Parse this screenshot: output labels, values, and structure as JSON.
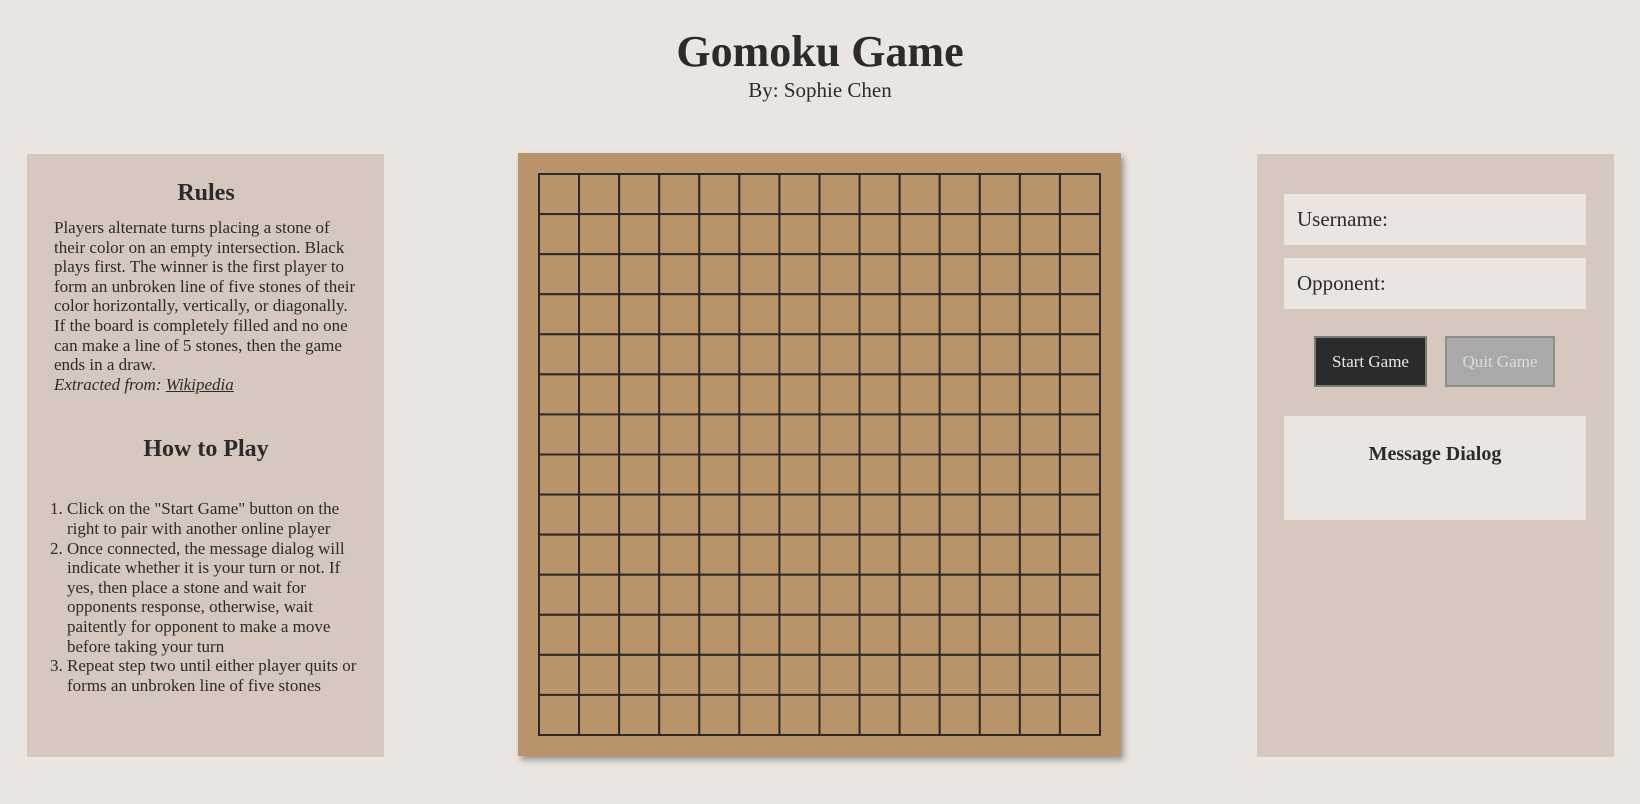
{
  "header": {
    "title": "Gomoku Game",
    "subtitle": "By: Sophie Chen"
  },
  "rules": {
    "heading": "Rules",
    "text": "Players alternate turns placing a stone of their color on an empty intersection. Black plays first. The winner is the first player to form an unbroken line of five stones of their color horizontally, vertically, or diagonally. If the board is completely filled and no one can make a line of 5 stones, then the game ends in a draw.",
    "credit_prefix": "Extracted from: ",
    "credit_link": "Wikipedia"
  },
  "how_to_play": {
    "heading": "How to Play",
    "steps": [
      "Click on the \"Start Game\" button on the right to pair with another online player",
      "Once connected, the message dialog will indicate whether it is your turn or not. If yes, then place a stone and wait for opponents response, otherwise, wait paitently for opponent to make a move before taking your turn",
      "Repeat step two until either player quits or forms an unbroken line of five stones"
    ]
  },
  "board": {
    "rows": 14,
    "cols": 14,
    "board_color": "#b9936a",
    "line_color": "#2b2b2b"
  },
  "controls": {
    "username_placeholder": "Username:",
    "opponent_placeholder": "Opponent:",
    "start_label": "Start Game",
    "quit_label": "Quit Game",
    "message_title": "Message Dialog"
  },
  "colors": {
    "page_background": "#eae5e0",
    "panel_background": "#d6c8be",
    "start_button": "#2b2b2b",
    "quit_button_disabled": "#a9a9a9"
  }
}
